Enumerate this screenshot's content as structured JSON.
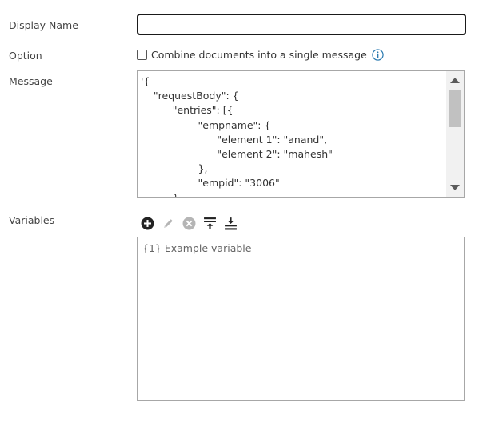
{
  "labels": {
    "display_name": "Display Name",
    "option": "Option",
    "message": "Message",
    "variables": "Variables"
  },
  "display_name_input": {
    "value": ""
  },
  "option": {
    "checkbox_label": "Combine documents into a single message",
    "checked": false
  },
  "message": {
    "lines": [
      {
        "text": "'{"
      },
      {
        "text": "    \"requestBody\": {"
      },
      {
        "text": "          \"entries\": [{"
      },
      {
        "text": "                  \"empname\": {"
      },
      {
        "text": "                        \"element 1\": \"anand\","
      },
      {
        "text": "                        \"element 2\": \"mahesh\""
      },
      {
        "text": "                  },"
      },
      {
        "text": "                  \"empid\": \"3006\""
      },
      {
        "text": "          }"
      }
    ]
  },
  "variables": {
    "items": [
      "{1} Example variable"
    ]
  },
  "icons": {
    "add": "plus-circle-icon",
    "edit": "pencil-icon",
    "delete": "x-circle-icon",
    "move_top": "move-to-top-icon",
    "move_bottom": "move-to-bottom-icon",
    "info": "info-icon"
  },
  "colors": {
    "info_accent": "#2a7ab0",
    "disabled_icon": "#b5b5b5",
    "active_icon": "#222222"
  }
}
